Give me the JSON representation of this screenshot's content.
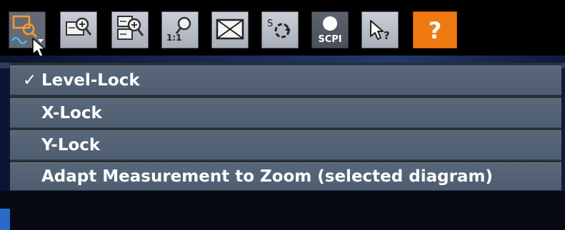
{
  "toolbar": {
    "buttons": [
      {
        "name": "zoom-mode-button",
        "icon": "zoom-mode-icon",
        "active": true
      },
      {
        "name": "zoom-button",
        "icon": "zoom-in-icon"
      },
      {
        "name": "multi-zoom-button",
        "icon": "multi-zoom-icon"
      },
      {
        "name": "zoom-off-button",
        "icon": "zoom-1-1-icon",
        "text": "1:1"
      },
      {
        "name": "full-screen-button",
        "icon": "full-screen-icon"
      },
      {
        "name": "sequencer-button",
        "icon": "sequencer-icon",
        "text": "S"
      },
      {
        "name": "scpi-recorder-button",
        "icon": "scpi-record-icon",
        "text": "SCPI"
      },
      {
        "name": "help-pointer-button",
        "icon": "help-pointer-icon",
        "text": "?"
      },
      {
        "name": "help-button",
        "icon": "help-icon",
        "text": "?"
      }
    ],
    "colors": {
      "help_accent": "#f07a12",
      "zoom_icon_accent": "#ff9a2e"
    }
  },
  "menu": {
    "items": [
      {
        "label": "Level-Lock",
        "checked": true,
        "check_mark": "✓"
      },
      {
        "label": "X-Lock",
        "checked": false
      },
      {
        "label": "Y-Lock",
        "checked": false
      },
      {
        "label": "Adapt Measurement to Zoom (selected diagram)",
        "checked": false
      }
    ]
  }
}
